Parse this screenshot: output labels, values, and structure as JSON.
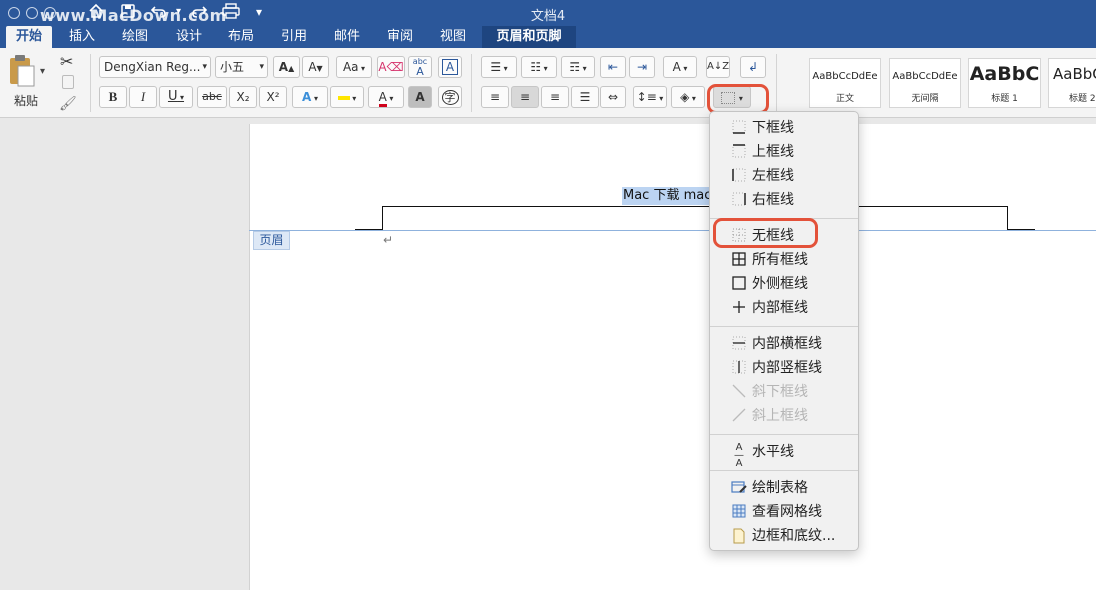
{
  "window": {
    "title": "文档4",
    "watermark": "www.MacDown.com"
  },
  "quick_access": {
    "home_icon": "home-icon",
    "save_icon": "save-icon",
    "undo_icon": "undo-icon",
    "redo_icon": "redo-icon",
    "print_icon": "print-icon",
    "customize_icon": "chevron-down-icon"
  },
  "tabs": [
    {
      "label": "开始",
      "active": true
    },
    {
      "label": "插入"
    },
    {
      "label": "绘图"
    },
    {
      "label": "设计"
    },
    {
      "label": "布局"
    },
    {
      "label": "引用"
    },
    {
      "label": "邮件"
    },
    {
      "label": "审阅"
    },
    {
      "label": "视图"
    },
    {
      "label": "页眉和页脚",
      "contextual": true
    }
  ],
  "ribbon": {
    "paste_label": "粘贴",
    "font_name": "DengXian Reg...",
    "font_size": "小五",
    "bold": "B",
    "italic": "I",
    "underline": "U",
    "strike": "abc",
    "subscript": "X₂",
    "superscript": "X²",
    "grow_font": "A",
    "shrink_font": "A",
    "change_case": "Aa",
    "text_effects": "A",
    "font_color": "A",
    "char_shading": "A",
    "enclose_char": "字",
    "phonetic": "abc",
    "border_char": "A",
    "styles": [
      {
        "sample": "AaBbCcDdEe",
        "name": "正文"
      },
      {
        "sample": "AaBbCcDdEe",
        "name": "无间隔"
      },
      {
        "sample": "AaBbC",
        "name": "标题 1"
      },
      {
        "sample": "AaBbC",
        "name": "标题 2"
      }
    ]
  },
  "document": {
    "selected_text": "Mac 下载 macd",
    "header_tag": "页眉",
    "paragraph_mark": "↵"
  },
  "border_menu": {
    "items": [
      {
        "label": "下框线",
        "icon": "bottom-border-icon"
      },
      {
        "label": "上框线",
        "icon": "top-border-icon"
      },
      {
        "label": "左框线",
        "icon": "left-border-icon"
      },
      {
        "label": "右框线",
        "icon": "right-border-icon"
      },
      {
        "label": "无框线",
        "icon": "no-border-icon",
        "highlighted": true
      },
      {
        "label": "所有框线",
        "icon": "all-borders-icon"
      },
      {
        "label": "外侧框线",
        "icon": "outside-borders-icon"
      },
      {
        "label": "内部框线",
        "icon": "inside-borders-icon"
      },
      {
        "label": "内部横框线",
        "icon": "inside-horizontal-border-icon"
      },
      {
        "label": "内部竖框线",
        "icon": "inside-vertical-border-icon"
      },
      {
        "label": "斜下框线",
        "icon": "diagonal-down-border-icon",
        "disabled": true
      },
      {
        "label": "斜上框线",
        "icon": "diagonal-up-border-icon",
        "disabled": true
      },
      {
        "label": "水平线",
        "icon": "horizontal-line-icon"
      },
      {
        "label": "绘制表格",
        "icon": "draw-table-icon"
      },
      {
        "label": "查看网格线",
        "icon": "view-gridlines-icon"
      },
      {
        "label": "边框和底纹...",
        "icon": "borders-shading-icon"
      }
    ]
  },
  "colors": {
    "accent": "#2b579a",
    "highlight_ring": "#e3523a",
    "selection": "#bcd4f2",
    "font_color_bar": "#d0021b",
    "highlighter": "#ffe600"
  }
}
